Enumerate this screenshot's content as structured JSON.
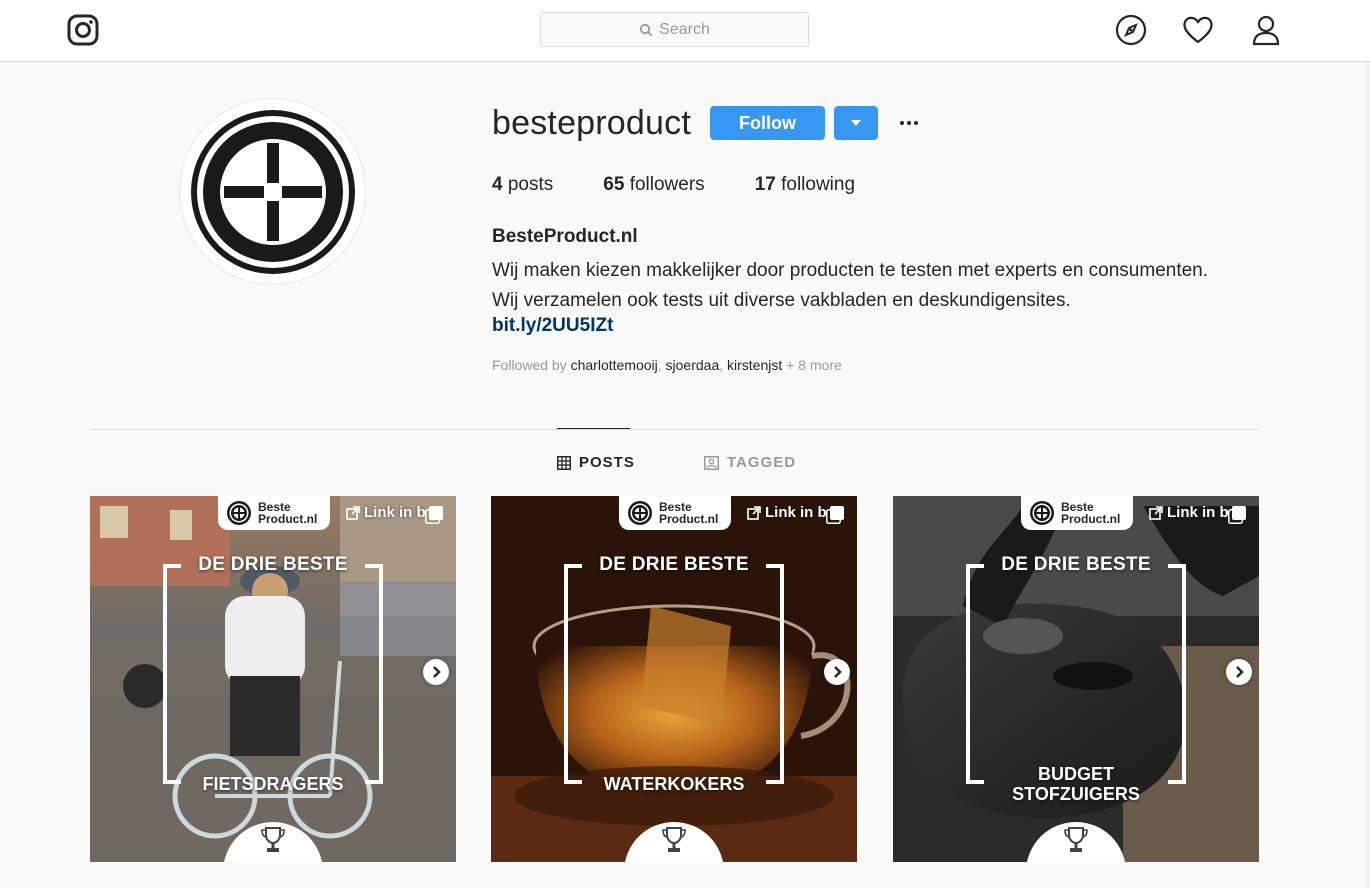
{
  "nav": {
    "search_placeholder": "Search"
  },
  "profile": {
    "username": "besteproduct",
    "follow_label": "Follow",
    "stats": [
      {
        "count": "4",
        "label": "posts"
      },
      {
        "count": "65",
        "label": "followers"
      },
      {
        "count": "17",
        "label": "following"
      }
    ],
    "full_name": "BesteProduct.nl",
    "bio_line1": "Wij maken kiezen makkelijker door producten te testen met experts en consumenten.",
    "bio_line2": "Wij verzamelen ook tests uit diverse vakbladen en deskundigensites.",
    "link": "bit.ly/2UU5IZt",
    "followed_by": {
      "prefix": "Followed by",
      "users": [
        "charlottemooij",
        "sjoerdaa",
        "kirstenjst"
      ],
      "more": "+ 8 more"
    }
  },
  "tabs": {
    "posts": "POSTS",
    "tagged": "TAGGED"
  },
  "posts": [
    {
      "badge_l1": "Beste",
      "badge_l2": "Product.nl",
      "link": "Link in b",
      "headline": "DE DRIE BESTE",
      "title_l1": "FIETSDRAGERS",
      "title_l2": ""
    },
    {
      "badge_l1": "Beste",
      "badge_l2": "Product.nl",
      "link": "Link in b",
      "headline": "DE DRIE BESTE",
      "title_l1": "WATERKOKERS",
      "title_l2": ""
    },
    {
      "badge_l1": "Beste",
      "badge_l2": "Product.nl",
      "link": "Link in b",
      "headline": "DE DRIE BESTE",
      "title_l1": "BUDGET",
      "title_l2": "STOFZUIGERS"
    }
  ],
  "colors": {
    "accent": "#3897f0",
    "link": "#003569",
    "muted": "#999999",
    "border": "#dbdbdb"
  },
  "icons": [
    "instagram-icon",
    "search-icon",
    "explore-compass-icon",
    "heart-icon",
    "profile-icon",
    "grid-icon",
    "tagged-icon",
    "external-link-icon",
    "multiple-posts-icon",
    "chevron-right-icon",
    "trophy-icon",
    "caret-down-icon"
  ]
}
